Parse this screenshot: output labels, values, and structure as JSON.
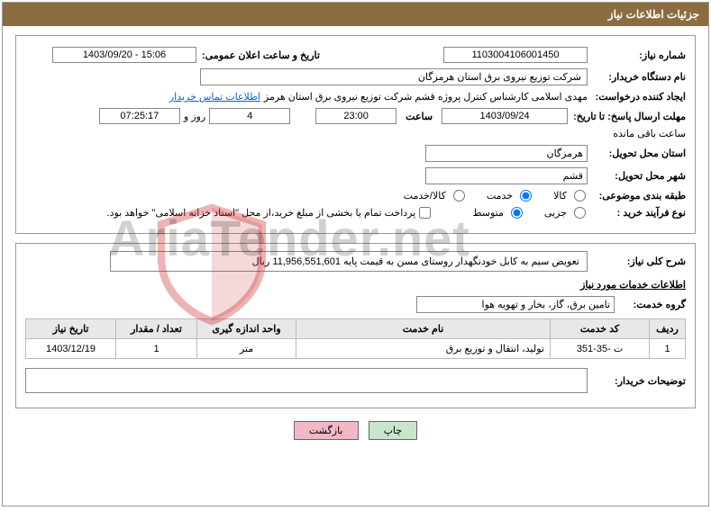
{
  "header": {
    "title": "جزئیات اطلاعات نیاز"
  },
  "fields": {
    "need_no_label": "شماره نیاز:",
    "need_no": "1103004106001450",
    "announce_label": "تاریخ و ساعت اعلان عمومی:",
    "announce_val": "1403/09/20 - 15:06",
    "buyer_org_label": "نام دستگاه خریدار:",
    "buyer_org": "شرکت توزیع نیروی برق استان هرمزگان",
    "requester_label": "ایجاد کننده درخواست:",
    "requester": "مهدی اسلامی کارشناس کنترل پروژه قشم شرکت توزیع نیروی برق استان هرمز",
    "contact_link": "اطلاعات تماس خریدار",
    "deadline_label": "مهلت ارسال پاسخ: تا تاریخ:",
    "deadline_date": "1403/09/24",
    "time_label": "ساعت",
    "deadline_time": "23:00",
    "days_val": "4",
    "days_suffix": "روز و",
    "remaining_time": "07:25:17",
    "remaining_suffix": "ساعت باقی مانده",
    "province_label": "استان محل تحویل:",
    "province": "هرمزگان",
    "city_label": "شهر محل تحویل:",
    "city": "قشم",
    "category_label": "طبقه بندی موضوعی:",
    "cat_goods": "کالا",
    "cat_service": "خدمت",
    "cat_both": "کالا/خدمت",
    "buy_type_label": "نوع فرآیند خرید :",
    "buy_partial": "جزیی",
    "buy_medium": "متوسط",
    "payment_note": "پرداخت تمام یا بخشی از مبلغ خرید،از محل \"اسناد خزانه اسلامی\" خواهد بود.",
    "overall_label": "شرح کلی نیاز:",
    "overall_desc": "تعویض سیم به کابل خودنگهدار روستای مسن به قیمت پایه  11,956,551,601  ریال",
    "services_title": "اطلاعات خدمات مورد نیاز",
    "service_group_label": "گروه خدمت:",
    "service_group": "تامین برق، گاز، بخار و تهویه هوا",
    "buyer_comment_label": "توضیحات خریدار:"
  },
  "table": {
    "headers": {
      "row": "ردیف",
      "code": "کد خدمت",
      "name": "نام خدمت",
      "unit": "واحد اندازه گیری",
      "qty": "تعداد / مقدار",
      "date": "تاریخ نیاز"
    },
    "rows": [
      {
        "idx": "1",
        "code": "ت -35-351",
        "name": "تولید، انتقال و توزیع برق",
        "unit": "متر",
        "qty": "1",
        "date": "1403/12/19"
      }
    ]
  },
  "buttons": {
    "print": "چاپ",
    "back": "بازگشت"
  },
  "watermark": "AriaTender.net"
}
